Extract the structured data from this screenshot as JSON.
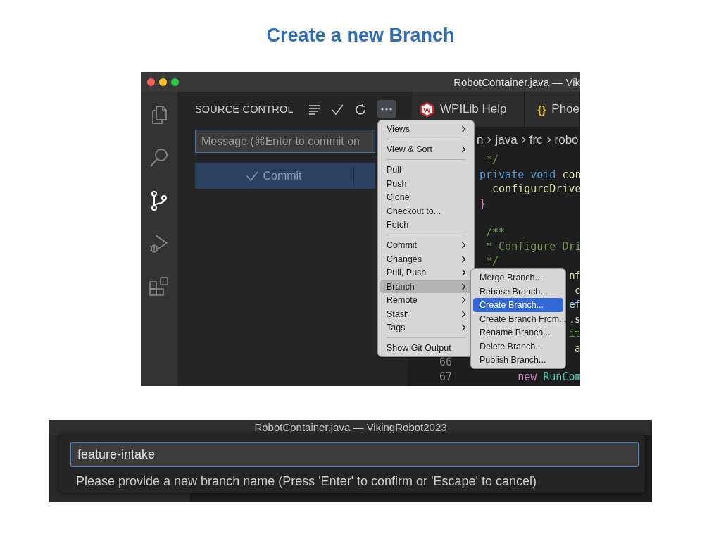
{
  "slide": {
    "title": "Create a new Branch"
  },
  "vscode_window": {
    "title": "RobotContainer.java — Vik",
    "activity_bar": [
      {
        "kind": "explorer",
        "selected": false
      },
      {
        "kind": "search",
        "selected": false
      },
      {
        "kind": "source-control",
        "selected": true
      },
      {
        "kind": "run",
        "selected": false
      },
      {
        "kind": "extensions",
        "selected": false
      }
    ],
    "sidebar": {
      "title": "SOURCE CONTROL",
      "message_placeholder": "Message (⌘Enter to commit on",
      "commit_button": "Commit"
    },
    "editor_tabs": [
      {
        "kind": "wpilib",
        "label": "WPILib Help"
      },
      {
        "kind": "json",
        "icon": "{}",
        "label": "Phoe"
      }
    ],
    "breadcrumb": [
      "n",
      "java",
      "frc",
      "robo"
    ],
    "code_lines": [
      {
        "kind": "code",
        "tokens": [
          {
            "text": " */",
            "color": "#6a9955"
          }
        ]
      },
      {
        "kind": "code",
        "tokens": [
          {
            "text": "private void ",
            "color": "#569cd6"
          },
          {
            "text": "con",
            "color": "#dcdcaa"
          }
        ]
      },
      {
        "kind": "code",
        "tokens": [
          {
            "text": "  configureDrive",
            "color": "#dcdcaa"
          }
        ]
      },
      {
        "kind": "code",
        "tokens": [
          {
            "text": "}",
            "color": "#c586c0"
          }
        ]
      },
      {
        "kind": "blank"
      },
      {
        "kind": "code",
        "tokens": [
          {
            "text": " /**",
            "color": "#6a9955"
          }
        ]
      },
      {
        "kind": "code",
        "tokens": [
          {
            "text": " * Configure Dri",
            "color": "#6a9955"
          }
        ]
      },
      {
        "kind": "code",
        "tokens": [
          {
            "text": " */",
            "color": "#6a9955"
          }
        ]
      },
      {
        "kind": "partial",
        "tokens": [
          {
            "text": "nf",
            "color": "#dcdcaa"
          }
        ]
      },
      {
        "kind": "partial",
        "tokens": [
          {
            "text": "c",
            "color": "#dcdcaa"
          }
        ]
      },
      {
        "kind": "partial",
        "tokens": [
          {
            "text": "ef",
            "color": "#9cdcfe"
          }
        ]
      },
      {
        "kind": "partial",
        "tokens": [
          {
            "text": ".s",
            "color": "#d4d4d4"
          }
        ]
      },
      {
        "kind": "partial",
        "tokens": [
          {
            "text": "it",
            "color": "#6a9955"
          }
        ]
      },
      {
        "kind": "partial",
        "tokens": [
          {
            "text": "a",
            "color": "#dcdcaa"
          }
        ]
      },
      {
        "kind": "blank",
        "number": "66"
      },
      {
        "kind": "code",
        "number": "67",
        "tokens": [
          {
            "text": "      new ",
            "color": "#c586c0"
          },
          {
            "text": "RunCom",
            "color": "#4ec9b0"
          }
        ]
      }
    ],
    "menu": [
      {
        "kind": "item",
        "label": "Views",
        "submenu": true,
        "selected": false
      },
      {
        "kind": "separator"
      },
      {
        "kind": "item",
        "label": "View & Sort",
        "submenu": true,
        "selected": false
      },
      {
        "kind": "separator"
      },
      {
        "kind": "item",
        "label": "Pull",
        "submenu": false,
        "selected": false
      },
      {
        "kind": "item",
        "label": "Push",
        "submenu": false,
        "selected": false
      },
      {
        "kind": "item",
        "label": "Clone",
        "submenu": false,
        "selected": false
      },
      {
        "kind": "item",
        "label": "Checkout to...",
        "submenu": false,
        "selected": false
      },
      {
        "kind": "item",
        "label": "Fetch",
        "submenu": false,
        "selected": false
      },
      {
        "kind": "separator"
      },
      {
        "kind": "item",
        "label": "Commit",
        "submenu": true,
        "selected": false
      },
      {
        "kind": "item",
        "label": "Changes",
        "submenu": true,
        "selected": false
      },
      {
        "kind": "item",
        "label": "Pull, Push",
        "submenu": true,
        "selected": false
      },
      {
        "kind": "item",
        "label": "Branch",
        "submenu": true,
        "selected": true
      },
      {
        "kind": "item",
        "label": "Remote",
        "submenu": true,
        "selected": false
      },
      {
        "kind": "item",
        "label": "Stash",
        "submenu": true,
        "selected": false
      },
      {
        "kind": "item",
        "label": "Tags",
        "submenu": true,
        "selected": false
      },
      {
        "kind": "separator"
      },
      {
        "kind": "item",
        "label": "Show Git Output",
        "submenu": false,
        "selected": false
      }
    ],
    "submenu": [
      {
        "kind": "item",
        "label": "Merge Branch...",
        "submenu": false,
        "selected": false
      },
      {
        "kind": "item",
        "label": "Rebase Branch...",
        "submenu": false,
        "selected": false
      },
      {
        "kind": "item",
        "label": "Create Branch...",
        "submenu": false,
        "selected": true
      },
      {
        "kind": "item",
        "label": "Create Branch From...",
        "submenu": false,
        "selected": false
      },
      {
        "kind": "item",
        "label": "Rename Branch...",
        "submenu": false,
        "selected": false
      },
      {
        "kind": "item",
        "label": "Delete Branch...",
        "submenu": false,
        "selected": false
      },
      {
        "kind": "item",
        "label": "Publish Branch...",
        "submenu": false,
        "selected": false
      }
    ]
  },
  "branch_prompt": {
    "window_title": "RobotContainer.java — VikingRobot2023",
    "value": "feature-intake",
    "message": "Please provide a new branch name (Press 'Enter' to confirm or 'Escape' to cancel)"
  }
}
